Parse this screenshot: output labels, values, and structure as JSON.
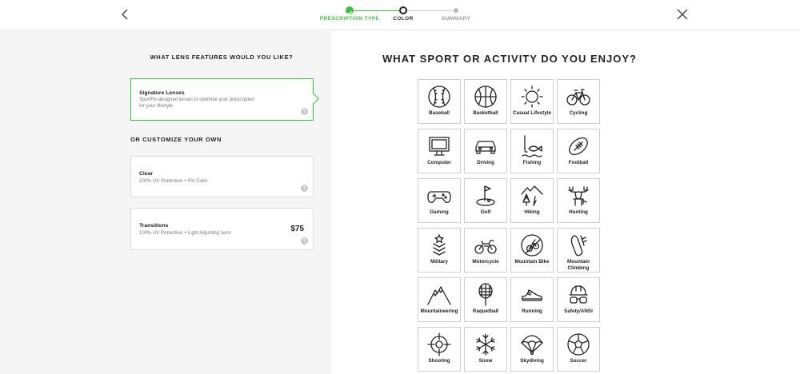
{
  "header": {
    "steps": [
      {
        "label": "PRESCRIPTION TYPE",
        "state": "complete"
      },
      {
        "label": "COLOR",
        "state": "current"
      },
      {
        "label": "SUMMARY",
        "state": "upcoming"
      }
    ],
    "colors": {
      "complete": "#3cc13c",
      "current": "#222222",
      "upcoming": "#bbbbbb"
    }
  },
  "left": {
    "title": "WHAT LENS FEATURES WOULD YOU LIKE?",
    "customize_title": "OR CUSTOMIZE YOUR OWN",
    "help_glyph": "?",
    "options": [
      {
        "name": "Signature Lenses",
        "desc": "SportRx-designed lenses to optimize your prescription for your lifestyle",
        "price": "",
        "selected": true
      },
      {
        "name": "Clear",
        "desc": "100% UV Protection + 0% Color",
        "price": "",
        "selected": false
      },
      {
        "name": "Transitions",
        "desc": "100% UV Protection + Light Adjusting Lens",
        "price": "$75",
        "selected": false
      }
    ]
  },
  "right": {
    "title": "WHAT SPORT OR ACTIVITY DO YOU ENJOY?",
    "activities": [
      {
        "label": "Baseball",
        "icon": "baseball-icon"
      },
      {
        "label": "Basketball",
        "icon": "basketball-icon"
      },
      {
        "label": "Casual Lifestyle",
        "icon": "sun-icon"
      },
      {
        "label": "Cycling",
        "icon": "bicycle-icon"
      },
      {
        "label": "Computer",
        "icon": "computer-icon"
      },
      {
        "label": "Driving",
        "icon": "car-icon"
      },
      {
        "label": "Fishing",
        "icon": "fish-icon"
      },
      {
        "label": "Football",
        "icon": "football-icon"
      },
      {
        "label": "Gaming",
        "icon": "gamepad-icon"
      },
      {
        "label": "Golf",
        "icon": "golf-icon"
      },
      {
        "label": "Hiking",
        "icon": "hiking-icon"
      },
      {
        "label": "Hunting",
        "icon": "moose-icon"
      },
      {
        "label": "Military",
        "icon": "military-icon"
      },
      {
        "label": "Motorcycle",
        "icon": "motorcycle-icon"
      },
      {
        "label": "Mountain Bike",
        "icon": "mountain-bike-icon"
      },
      {
        "label": "Mountain Climbing",
        "icon": "carabiner-icon"
      },
      {
        "label": "Mountaineering",
        "icon": "mountain-icon"
      },
      {
        "label": "Raquetball",
        "icon": "racquet-icon"
      },
      {
        "label": "Running",
        "icon": "shoe-icon"
      },
      {
        "label": "Safety/ANSI",
        "icon": "safety-icon"
      },
      {
        "label": "Shooting",
        "icon": "crosshair-icon"
      },
      {
        "label": "Snow",
        "icon": "snowflake-icon"
      },
      {
        "label": "Skydiving",
        "icon": "parachute-icon"
      },
      {
        "label": "Soccer",
        "icon": "soccer-icon"
      }
    ]
  }
}
